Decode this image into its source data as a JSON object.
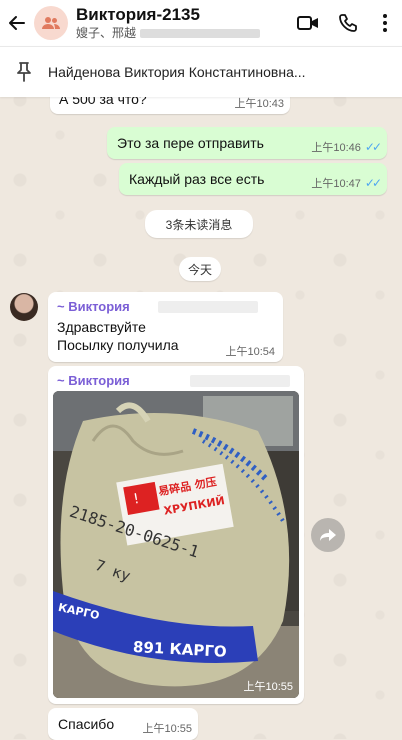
{
  "header": {
    "title": "Виктория-2135",
    "subtitle": "嫂子、邢越"
  },
  "pinned": {
    "text": "Найденова Виктория Константиновна..."
  },
  "messages": {
    "m1": {
      "text": "А 500 за что?",
      "time": "上午10:43"
    },
    "m2": {
      "text": "Это за пере отправить",
      "time": "上午10:46"
    },
    "m3": {
      "text": "Каждый раз все есть",
      "time": "上午10:47"
    },
    "unread": "3条未读消息",
    "today": "今天",
    "m4": {
      "sender": "~ Виктория",
      "line1": "Здравствуйте",
      "line2": "Посылку получила",
      "time": "上午10:54"
    },
    "m5": {
      "sender": "~ Виктория",
      "time": "上午10:55",
      "photo_text": {
        "label_cn": "易碎品 勿压",
        "label_ru": "ХРУПКИЙ",
        "handwritten": "2185-20-0625-1",
        "weight": "7 ку",
        "tape_left": "КАРГО",
        "tape_brand": "891 КАРГО"
      }
    },
    "m6": {
      "text": "Спасибо",
      "time": "上午10:55"
    }
  },
  "colors": {
    "header_bg": "#ffffff",
    "chat_bg": "#efe8df",
    "outgoing": "#d9fdd3",
    "incoming": "#ffffff",
    "sender": "#7b5fd6",
    "ticks": "#4fa6f0"
  }
}
